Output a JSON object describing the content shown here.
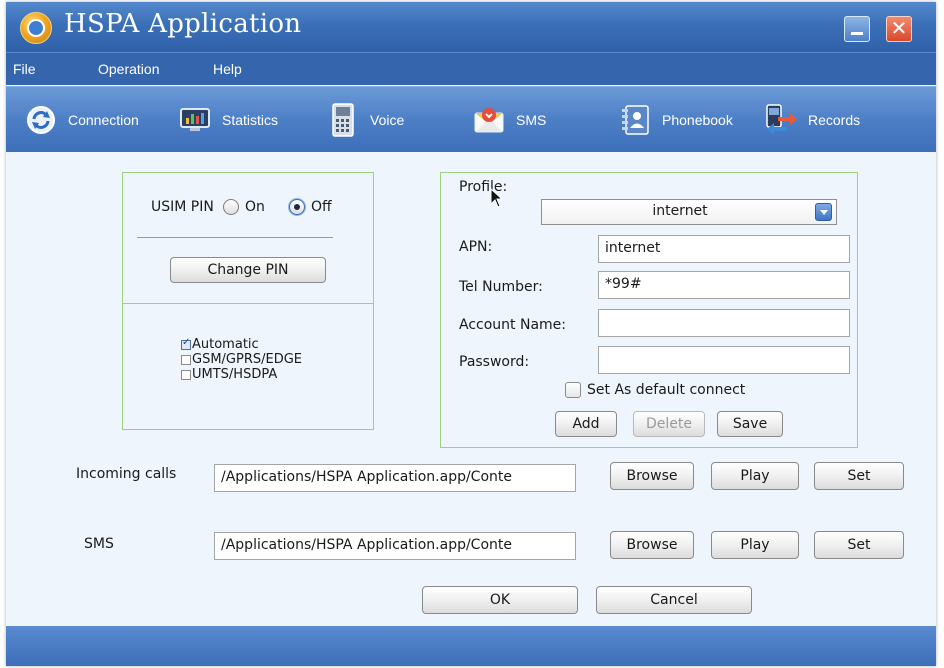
{
  "window": {
    "title": "HSPA Application",
    "close_glyph": "✕"
  },
  "menu": {
    "items": [
      {
        "label": "File"
      },
      {
        "label": "Operation"
      },
      {
        "label": "Help"
      }
    ]
  },
  "toolbar": {
    "items": [
      {
        "label": "Connection",
        "icon": "connection-icon"
      },
      {
        "label": "Statistics",
        "icon": "statistics-icon"
      },
      {
        "label": "Voice",
        "icon": "voice-icon"
      },
      {
        "label": "SMS",
        "icon": "sms-icon"
      },
      {
        "label": "Phonebook",
        "icon": "phonebook-icon"
      },
      {
        "label": "Records",
        "icon": "records-icon"
      }
    ]
  },
  "pin": {
    "label": "USIM PIN",
    "on_label": "On",
    "off_label": "Off",
    "selected": "Off",
    "change_button": "Change PIN"
  },
  "network": {
    "options": [
      {
        "label": "Automatic",
        "checked": true
      },
      {
        "label": "GSM/GPRS/EDGE",
        "checked": false
      },
      {
        "label": "UMTS/HSDPA",
        "checked": false
      }
    ]
  },
  "profile": {
    "label": "Profile:",
    "selected": "internet",
    "apn_label": "APN:",
    "apn_value": "internet",
    "tel_label": "Tel Number:",
    "tel_value": "*99#",
    "account_label": "Account Name:",
    "account_value": "",
    "password_label": "Password:",
    "password_value": "",
    "default_label": "Set As default connect",
    "default_checked": false,
    "add_button": "Add",
    "delete_button": "Delete",
    "save_button": "Save"
  },
  "ringtones": {
    "incoming_label": "Incoming calls",
    "incoming_path": "/Applications/HSPA Application.app/Conte",
    "sms_label": "SMS",
    "sms_path": "/Applications/HSPA Application.app/Conte",
    "browse_button": "Browse",
    "play_button": "Play",
    "set_button": "Set"
  },
  "dialog": {
    "ok_button": "OK",
    "cancel_button": "Cancel"
  },
  "colors": {
    "titlebar": "#3b6fb8",
    "panel_border": "#9fd07e",
    "background": "#eef5fc"
  }
}
